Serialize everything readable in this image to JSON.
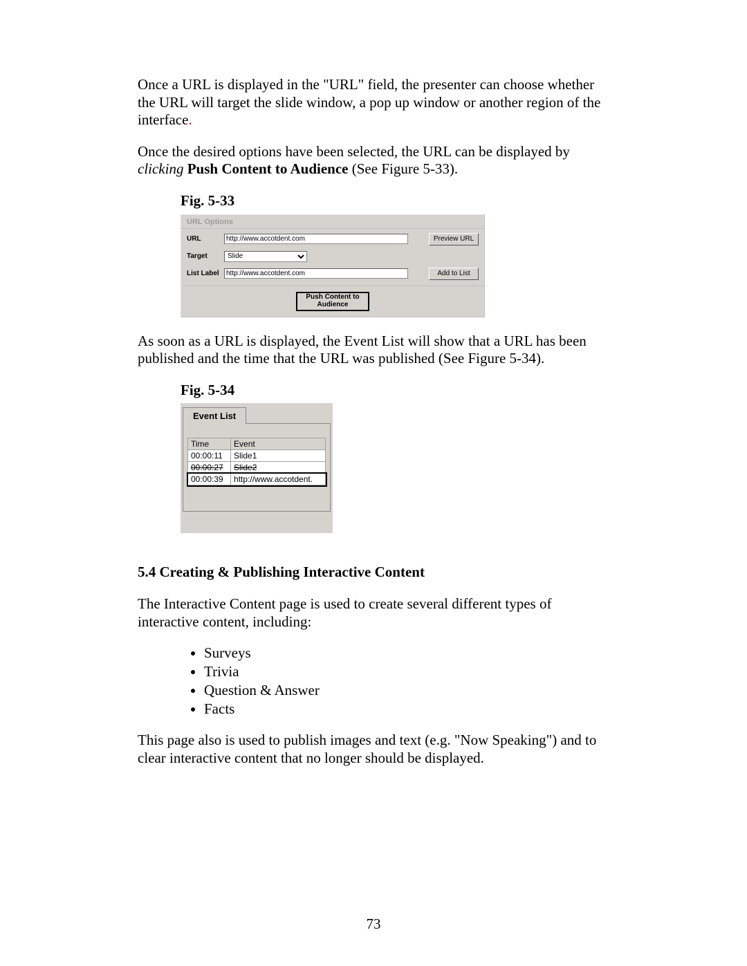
{
  "paragraphs": {
    "p1a": "Once a URL is displayed in the \"URL\" field, the presenter can choose whether the URL will target the slide window, a pop up window or another region of the interface",
    "p2a": "Once the desired options have been selected, the URL can be displayed by ",
    "p2b": "clicking",
    "p2c": " ",
    "p2d": "Push Content to Audience",
    "p2e": " (See Figure 5-33).",
    "p3": "As soon as a URL is displayed, the Event List will show that a URL has been published and the time that the URL was published (See Figure 5-34).",
    "p4": "The Interactive Content page is used to create several different types of interactive content, including:",
    "p5": "This page also is used to publish images and text (e.g. \"Now Speaking\") and to clear interactive content that no longer should be displayed."
  },
  "fig33": {
    "caption": "Fig. 5-33",
    "panel_title": "URL Options",
    "url_label": "URL",
    "url_value": "http://www.accotdent.com",
    "preview_btn": "Preview URL",
    "target_label": "Target",
    "target_value": "Slide",
    "listlabel_label": "List Label",
    "listlabel_value": "http://www.accotdent.com",
    "add_btn": "Add to List",
    "push_btn_l1": "Push Content to",
    "push_btn_l2": "Audience"
  },
  "fig34": {
    "caption": "Fig. 5-34",
    "tab_label": "Event List",
    "headers": {
      "time": "Time",
      "event": "Event"
    },
    "rows": [
      {
        "time": "00:00:11",
        "event": "Slide1"
      },
      {
        "time": "00:00:27",
        "event": "Slide2"
      },
      {
        "time": "00:00:39",
        "event": "http://www.accotdent."
      }
    ]
  },
  "section54": {
    "heading": "5.4  Creating & Publishing Interactive Content",
    "bullets": [
      "Surveys",
      "Trivia",
      "Question & Answer",
      "Facts"
    ]
  },
  "page_number": "73"
}
